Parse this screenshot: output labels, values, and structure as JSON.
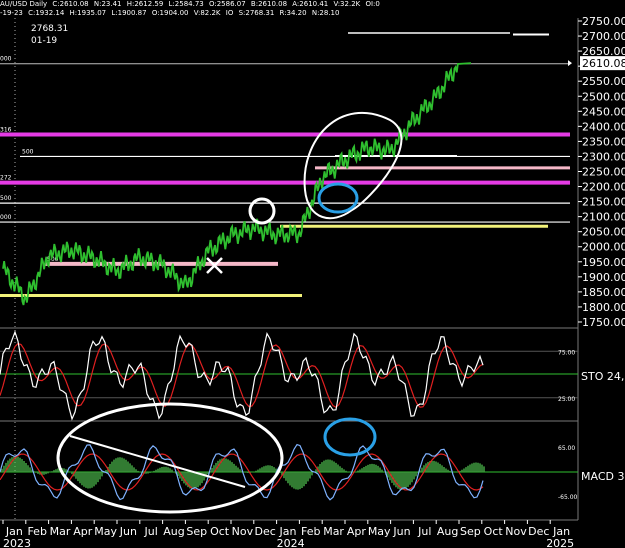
{
  "header": {
    "symbol": "AU/USD Daily",
    "ohlc": [
      "C:2610.08",
      "N:23.41",
      "H:2612.59",
      "L:2584.73",
      "O:2586.07",
      "B:2610.08",
      "A:2610.41",
      "V:32.2K",
      "OI:0"
    ],
    "prev_bar": [
      "-19-23",
      "C:1932.14",
      "H:1935.07",
      "L:1900.87",
      "O:1904.00",
      "V:82.2K",
      "IO",
      "S:2768.31",
      "R:34.20",
      "N:28.10"
    ]
  },
  "cursor": {
    "value": "2768.31",
    "date": "01-19"
  },
  "colors": {
    "background": "#000000",
    "price": "#2fbf2f",
    "magenta": "#e53be5",
    "pink": "#f5b8c8",
    "yellow": "#f2f27a",
    "white": "#ffffff",
    "gray": "#bdbdbd",
    "signal": "#e02020",
    "macd_fast": "#7fb2ff",
    "histogram": "#3f9a3f",
    "annotation_blue": "#2aa0e6"
  },
  "chart_data": [
    {
      "type": "line",
      "name": "price",
      "x_axis_labels": [
        "Jan",
        "Feb",
        "Mar",
        "Apr",
        "May",
        "Jun",
        "Jul",
        "Aug",
        "Sep",
        "Oct",
        "Nov",
        "Dec",
        "Jan",
        "Feb",
        "Mar",
        "Apr",
        "May",
        "Jun",
        "Jul",
        "Aug",
        "Sep",
        "Oct",
        "Nov",
        "Dec",
        "Jan"
      ],
      "year_labels": [
        "2023",
        "2024",
        "2025"
      ],
      "ylim": [
        1730,
        2760
      ],
      "y_ticks": [
        1750,
        1800,
        1850,
        1900,
        1950,
        2000,
        2050,
        2100,
        2150,
        2200,
        2250,
        2300,
        2350,
        2400,
        2450,
        2500,
        2550,
        2600,
        2650,
        2700,
        2750
      ],
      "last_price_label": "2610.08",
      "monthly_closes": [
        {
          "date": "2023-01",
          "value": 1927
        },
        {
          "date": "2023-02",
          "value": 1827
        },
        {
          "date": "2023-03",
          "value": 1970
        },
        {
          "date": "2023-04",
          "value": 1990
        },
        {
          "date": "2023-05",
          "value": 1962
        },
        {
          "date": "2023-06",
          "value": 1919
        },
        {
          "date": "2023-07",
          "value": 1965
        },
        {
          "date": "2023-08",
          "value": 1940
        },
        {
          "date": "2023-09",
          "value": 1870
        },
        {
          "date": "2023-10",
          "value": 1985
        },
        {
          "date": "2023-11",
          "value": 2037
        },
        {
          "date": "2023-12",
          "value": 2063
        },
        {
          "date": "2024-01",
          "value": 2040
        },
        {
          "date": "2024-02",
          "value": 2045
        },
        {
          "date": "2024-03",
          "value": 2230
        },
        {
          "date": "2024-04",
          "value": 2290
        },
        {
          "date": "2024-05",
          "value": 2330
        },
        {
          "date": "2024-06",
          "value": 2320
        },
        {
          "date": "2024-07",
          "value": 2420
        },
        {
          "date": "2024-08",
          "value": 2500
        },
        {
          "date": "2024-09",
          "value": 2610
        }
      ],
      "horizontal_levels": [
        {
          "value": 2373,
          "color": "magenta",
          "label": "316"
        },
        {
          "value": 2300,
          "color": "white",
          "label": "500"
        },
        {
          "value": 2213,
          "color": "magenta",
          "label": "272"
        },
        {
          "value": 2145,
          "color": "white",
          "label": "500"
        },
        {
          "value": 2082,
          "color": "white",
          "label": "000"
        },
        {
          "value": 2608,
          "color": "gray",
          "label": "000"
        },
        {
          "value": 1943,
          "color": "pink",
          "label": "500"
        },
        {
          "value": 2262,
          "color": "pink"
        },
        {
          "value": 1838,
          "color": "yellow"
        },
        {
          "value": 2068,
          "color": "yellow"
        },
        {
          "value": 2710,
          "color": "gray"
        },
        {
          "value": 2303,
          "color": "white"
        }
      ]
    },
    {
      "type": "line",
      "name": "STO 24",
      "ylim": [
        0,
        100
      ],
      "y_ticks": [
        25,
        75
      ],
      "label": "STO 24,"
    },
    {
      "type": "line",
      "name": "MACD 3",
      "y_ticks": [
        65,
        -65
      ],
      "y_tick_labels": [
        "65.00",
        "-65.00"
      ],
      "label": "MACD 3,"
    }
  ]
}
